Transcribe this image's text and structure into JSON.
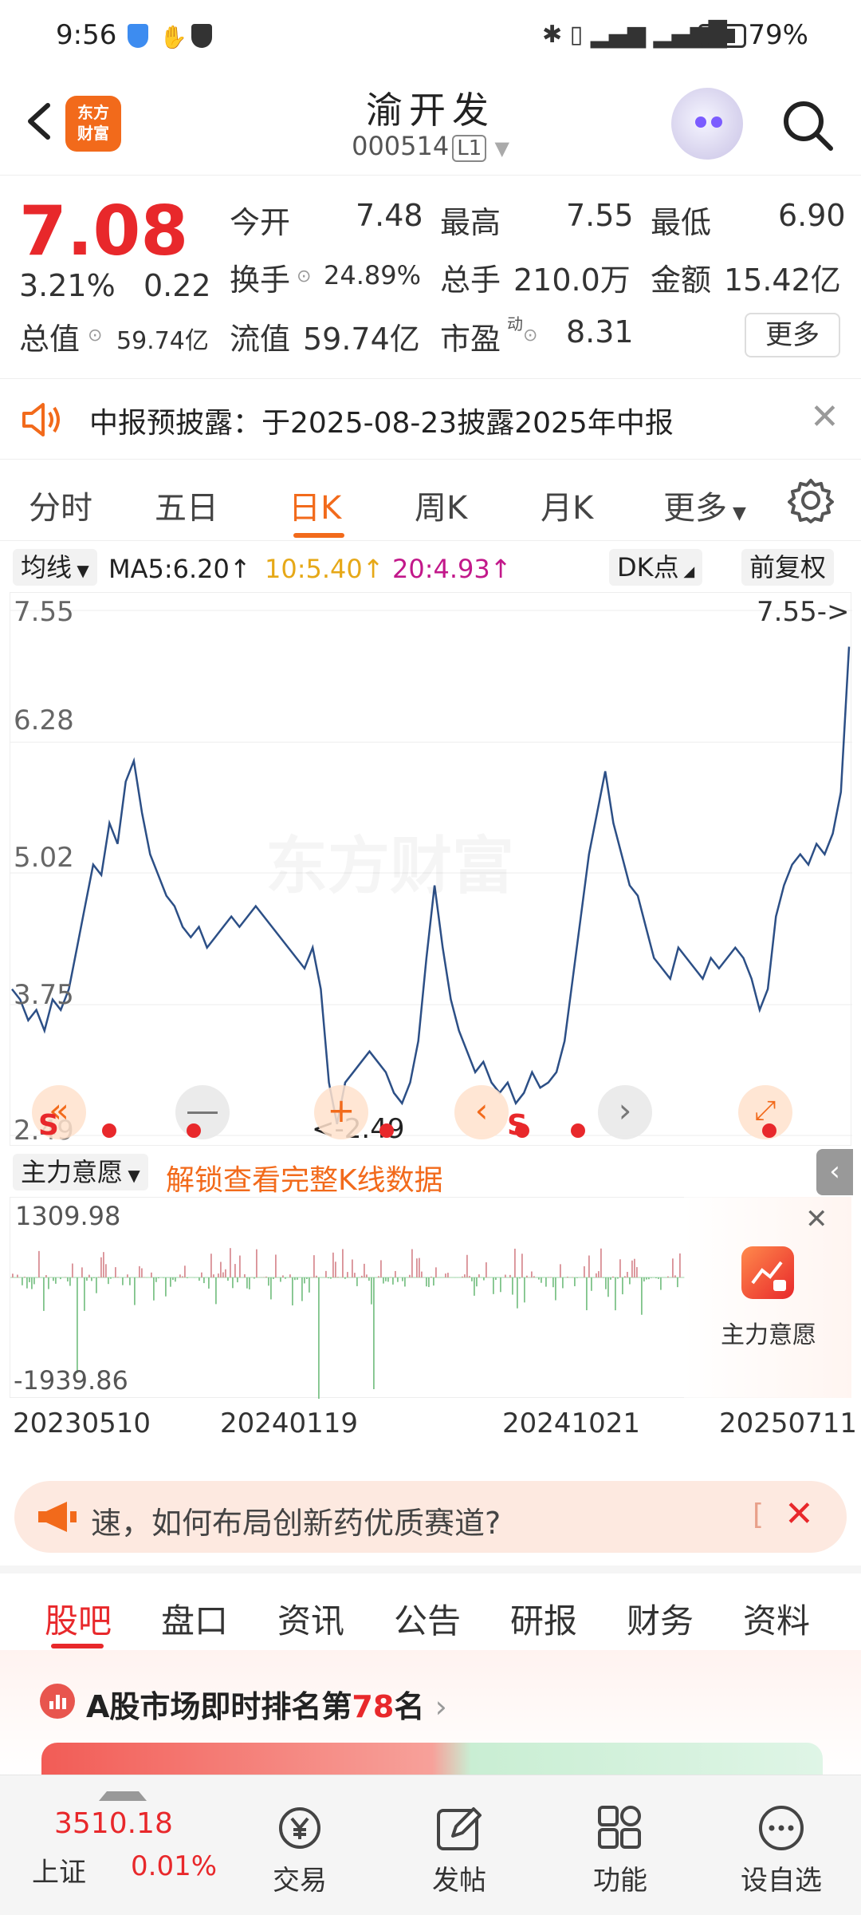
{
  "status_bar": {
    "time": "9:56",
    "battery": "79%"
  },
  "header": {
    "app_logo_line1": "东方",
    "app_logo_line2": "财富",
    "stock_name": "渝开发",
    "stock_code": "000514",
    "level": "L1"
  },
  "quote": {
    "price": "7.08",
    "change_pct": "3.21%",
    "change_amt": "0.22",
    "open_label": "今开",
    "open_value": "7.48",
    "high_label": "最高",
    "high_value": "7.55",
    "low_label": "最低",
    "low_value": "6.90",
    "turnover_label": "换手",
    "turnover_value": "24.89%",
    "volume_label": "总手",
    "volume_value": "210.0万",
    "amount_label": "金额",
    "amount_value": "15.42亿",
    "mktcap_label": "总值",
    "mktcap_value": "59.74亿",
    "float_label": "流值",
    "float_value": "59.74亿",
    "pe_label": "市盈",
    "pe_sup": "动",
    "pe_value": "8.31",
    "more_label": "更多"
  },
  "notice": {
    "text": "中报预披露：于2025-08-23披露2025年中报"
  },
  "period_tabs": [
    "分时",
    "五日",
    "日K",
    "周K",
    "月K",
    "更多"
  ],
  "ma": {
    "selector": "均线",
    "ma5": "MA5:6.20↑",
    "ma10": "10:5.40↑",
    "ma20": "20:4.93↑",
    "dk": "DK点",
    "adjust": "前复权"
  },
  "colors": {
    "accent": "#f26a1b",
    "up": "#e8282b",
    "down": "#2e9e3c",
    "line": "#2c4f86",
    "ma10": "#e6a817",
    "ma20": "#c2188a"
  },
  "chart_data": {
    "type": "line",
    "title": "",
    "ylim": [
      2.49,
      7.55
    ],
    "y_ticks": [
      "7.55",
      "6.28",
      "5.02",
      "3.75",
      "2.49"
    ],
    "high_marker": "7.55->",
    "low_marker": "<-2.49",
    "x_ticks": [
      "20230510",
      "20240119",
      "20241021",
      "20250711"
    ],
    "values": [
      3.9,
      3.8,
      3.6,
      3.7,
      3.5,
      3.8,
      3.7,
      3.9,
      4.3,
      4.7,
      5.1,
      5.0,
      5.5,
      5.3,
      5.9,
      6.1,
      5.6,
      5.2,
      5.0,
      4.8,
      4.7,
      4.5,
      4.4,
      4.5,
      4.3,
      4.4,
      4.5,
      4.6,
      4.5,
      4.6,
      4.7,
      4.6,
      4.5,
      4.4,
      4.3,
      4.2,
      4.1,
      4.3,
      3.9,
      3.0,
      2.6,
      3.0,
      3.1,
      3.2,
      3.3,
      3.2,
      3.1,
      2.9,
      2.8,
      3.0,
      3.4,
      4.2,
      4.9,
      4.3,
      3.8,
      3.5,
      3.3,
      3.1,
      3.2,
      3.0,
      2.9,
      3.0,
      2.8,
      2.9,
      3.1,
      2.95,
      3.0,
      3.1,
      3.4,
      4.0,
      4.6,
      5.2,
      5.6,
      6.0,
      5.5,
      5.2,
      4.9,
      4.8,
      4.5,
      4.2,
      4.1,
      4.0,
      4.3,
      4.2,
      4.1,
      4.0,
      4.2,
      4.1,
      4.2,
      4.3,
      4.2,
      4.0,
      3.7,
      3.9,
      4.6,
      4.9,
      5.1,
      5.2,
      5.1,
      5.3,
      5.2,
      5.4,
      5.8,
      7.2
    ],
    "mainforce_ylim": [
      -1939.86,
      1309.98
    ],
    "mainforce_labels": [
      "1309.98",
      "-1939.86"
    ]
  },
  "mainforce": {
    "selector": "主力意愿",
    "unlock_text": "解锁查看完整K线数据",
    "side_label": "主力意愿"
  },
  "banner": {
    "text": "速，如何布局创新药优质赛道?"
  },
  "bottom_tabs": [
    "股吧",
    "盘口",
    "资讯",
    "公告",
    "研报",
    "财务",
    "资料"
  ],
  "rank": {
    "prefix": "A股市场即时排名第",
    "number": "78",
    "suffix": "名"
  },
  "nav": {
    "index_value": "3510.18",
    "index_name": "上证",
    "index_change": "0.01%",
    "trade": "交易",
    "post": "发帖",
    "function": "功能",
    "watchlist": "设自选"
  }
}
